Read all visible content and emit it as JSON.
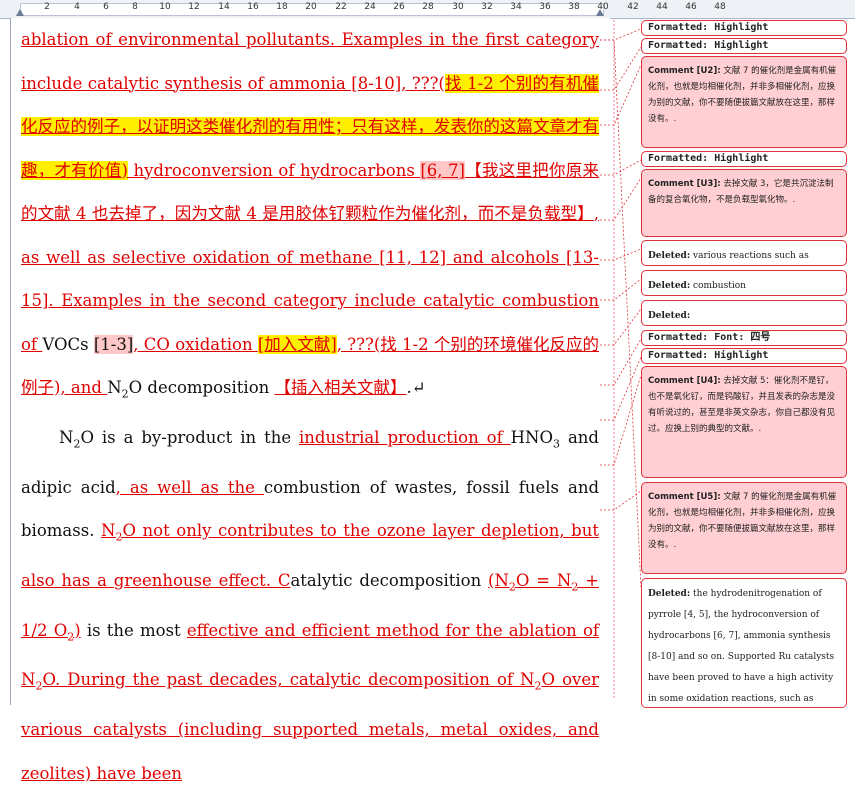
{
  "ruler": {
    "ticks": [
      "2",
      "2",
      "4",
      "6",
      "8",
      "10",
      "12",
      "14",
      "16",
      "18",
      "20",
      "22",
      "24",
      "26",
      "28",
      "30",
      "32",
      "34",
      "36",
      "38",
      "40",
      "42",
      "44",
      "46",
      "48"
    ]
  },
  "doc": {
    "p1": {
      "a": "ablation of environmental pollutants. Examples in the first category include catalytic synthesis of ammonia [8-10], ???(",
      "b": "找 1-2 个别的有机催化反应的例子，以证明这类催化剂的有用性；只有这样，发表你的这篇文章才有趣，才有价值",
      "c": ")",
      "d": " hydroconversion of hydrocarbons ",
      "e": "[6, 7]",
      "f": "【我这里把你原来的文献 4 也去掉了，因为文献 4 是用胶体钌颗粒作为催化剂，而不是负载型】",
      "g": ", as well as selective oxidation of methane [11, 12] and alcohols [13-15]. Examples in the second category include catalytic combustion of ",
      "h": "VOCs ",
      "i": "[1-3]",
      "j": ", CO oxidation ",
      "k": "[加入文献]",
      "l": ", ???(找 1-2 个别的环境催化反应的例子), and ",
      "m": "N",
      "m_sub": "2",
      "n": "O decomposition ",
      "o": "【插入相关文献】",
      "p": ".↵"
    },
    "p2": {
      "a": "N",
      "a_sub": "2",
      "b": "O is a by-product in ",
      "c": "the ",
      "d": "industrial production of ",
      "e": "HNO",
      "e_sub": "3",
      "f": " and adipic acid",
      "g": ", as well as the ",
      "h": "combustion of wastes, fossil fuels and biomass. ",
      "i": "N",
      "i_sub": "2",
      "j": "O not only contributes to the ozone layer depletion, but also has a greenhouse effect. C",
      "k": "atalytic decomposition ",
      "l1": "(N",
      "l1_sub": "2",
      "l2": "O = N",
      "l2_sub": "2",
      "l3": " + 1/2 O",
      "l3_sub": "2",
      "l4": ")",
      "m": " is the most ",
      "n": "effective and efficient method for the ablation of N",
      "n_sub": "2",
      "o": "O. During the past decades, catalytic decomposition of N",
      "o_sub": "2",
      "p": "O over various catalysts (including supported metals, metal oxides, and zeolites) have been"
    }
  },
  "balloons": [
    {
      "kind": "formatted",
      "label": "Formatted:",
      "text": " Highlight"
    },
    {
      "kind": "formatted",
      "label": "Formatted:",
      "text": " Highlight"
    },
    {
      "kind": "comment",
      "label": "Comment [U2]:",
      "text": " 文献 7 的催化剂是金属有机催化剂，也就是均相催化剂，并非多相催化剂，应换为别的文献，你不要随便拔篇文献放在这里，那样没有。."
    },
    {
      "kind": "formatted",
      "label": "Formatted:",
      "text": " Highlight"
    },
    {
      "kind": "comment",
      "label": "Comment [U3]:",
      "text": " 去掉文献 3，它是共沉淀法制备的复合氧化物，不是负载型氧化物。."
    },
    {
      "kind": "deleted",
      "label": "Deleted:",
      "text": " various reactions such as"
    },
    {
      "kind": "deleted",
      "label": "Deleted:",
      "text": " combustion"
    },
    {
      "kind": "deleted",
      "label": "Deleted:",
      "text": ""
    },
    {
      "kind": "formatted",
      "label": "Formatted:",
      "text": " Font: 四号"
    },
    {
      "kind": "formatted",
      "label": "Formatted:",
      "text": " Highlight"
    },
    {
      "kind": "comment",
      "label": "Comment [U4]:",
      "text": " 去掉文献 5：催化剂不是钌，也不是氧化钌，而是钨酸钌，并且发表的杂志是没有听说过的，甚至是非英文杂志，你自己都没有见过。应换上别的典型的文献。."
    },
    {
      "kind": "comment",
      "label": "Comment [U5]:",
      "text": " 文献 7 的催化剂是金属有机催化剂，也就是均相催化剂，并非多相催化剂，应换为别的文献，你不要随便拔篇文献放在这里，那样没有。."
    },
    {
      "kind": "deleted",
      "label": "Deleted:",
      "text": " the hydrodenitrogenation of pyrrole [4, 5], the hydroconversion of hydrocarbons [6, 7], ammonia synthesis [8-10] and so on. Supported Ru catalysts have been proved to have a high activity in some oxidation reactions, such as methane"
    }
  ]
}
